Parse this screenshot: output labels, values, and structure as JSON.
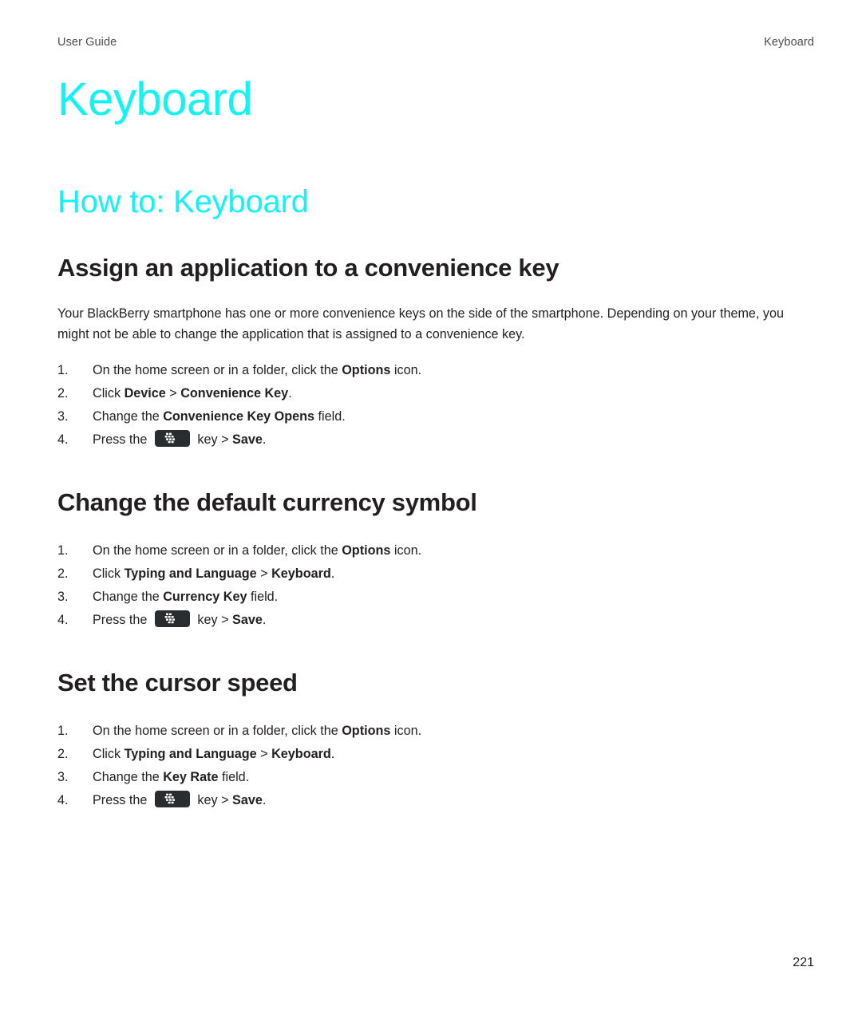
{
  "header": {
    "left": "User Guide",
    "right": "Keyboard"
  },
  "doc": {
    "title": "Keyboard",
    "section_title": "How to: Keyboard",
    "accent_color": "#12f3f3",
    "text_color": "#231f20",
    "page_number": "221"
  },
  "tasks": [
    {
      "title": "Assign an application to a convenience key",
      "intro": "Your BlackBerry smartphone has one or more convenience keys on the side of the smartphone. Depending on your theme, you might not be able to change the application that is assigned to a convenience key.",
      "steps": [
        {
          "num": "1.",
          "parts": [
            {
              "t": "On the home screen or in a folder, click the ",
              "b": false
            },
            {
              "t": "Options",
              "b": true
            },
            {
              "t": " icon.",
              "b": false
            }
          ]
        },
        {
          "num": "2.",
          "parts": [
            {
              "t": "Click ",
              "b": false
            },
            {
              "t": "Device",
              "b": true
            },
            {
              "t": " > ",
              "b": false
            },
            {
              "t": "Convenience Key",
              "b": true
            },
            {
              "t": ".",
              "b": false
            }
          ]
        },
        {
          "num": "3.",
          "parts": [
            {
              "t": "Change the ",
              "b": false
            },
            {
              "t": "Convenience Key Opens",
              "b": true
            },
            {
              "t": " field.",
              "b": false
            }
          ]
        },
        {
          "num": "4.",
          "icon": "blackberry-menu-key-icon",
          "parts": [
            {
              "t": "Press the ",
              "b": false
            },
            {
              "icon": "blackberry-menu-key-icon"
            },
            {
              "t": " key > ",
              "b": false
            },
            {
              "t": "Save",
              "b": true
            },
            {
              "t": ".",
              "b": false
            }
          ]
        }
      ]
    },
    {
      "title": "Change the default currency symbol",
      "intro": "",
      "steps": [
        {
          "num": "1.",
          "parts": [
            {
              "t": "On the home screen or in a folder, click the ",
              "b": false
            },
            {
              "t": "Options",
              "b": true
            },
            {
              "t": " icon.",
              "b": false
            }
          ]
        },
        {
          "num": "2.",
          "parts": [
            {
              "t": "Click ",
              "b": false
            },
            {
              "t": "Typing and Language",
              "b": true
            },
            {
              "t": " > ",
              "b": false
            },
            {
              "t": "Keyboard",
              "b": true
            },
            {
              "t": ".",
              "b": false
            }
          ]
        },
        {
          "num": "3.",
          "parts": [
            {
              "t": "Change the ",
              "b": false
            },
            {
              "t": "Currency Key",
              "b": true
            },
            {
              "t": " field.",
              "b": false
            }
          ]
        },
        {
          "num": "4.",
          "icon": "blackberry-menu-key-icon",
          "parts": [
            {
              "t": "Press the ",
              "b": false
            },
            {
              "icon": "blackberry-menu-key-icon"
            },
            {
              "t": " key > ",
              "b": false
            },
            {
              "t": "Save",
              "b": true
            },
            {
              "t": ".",
              "b": false
            }
          ]
        }
      ]
    },
    {
      "title": "Set the cursor speed",
      "intro": "",
      "steps": [
        {
          "num": "1.",
          "parts": [
            {
              "t": "On the home screen or in a folder, click the ",
              "b": false
            },
            {
              "t": "Options",
              "b": true
            },
            {
              "t": " icon.",
              "b": false
            }
          ]
        },
        {
          "num": "2.",
          "parts": [
            {
              "t": "Click ",
              "b": false
            },
            {
              "t": "Typing and Language",
              "b": true
            },
            {
              "t": " > ",
              "b": false
            },
            {
              "t": "Keyboard",
              "b": true
            },
            {
              "t": ".",
              "b": false
            }
          ]
        },
        {
          "num": "3.",
          "parts": [
            {
              "t": "Change the ",
              "b": false
            },
            {
              "t": "Key Rate",
              "b": true
            },
            {
              "t": " field.",
              "b": false
            }
          ]
        },
        {
          "num": "4.",
          "icon": "blackberry-menu-key-icon",
          "parts": [
            {
              "t": "Press the ",
              "b": false
            },
            {
              "icon": "blackberry-menu-key-icon"
            },
            {
              "t": " key > ",
              "b": false
            },
            {
              "t": "Save",
              "b": true
            },
            {
              "t": ".",
              "b": false
            }
          ]
        }
      ]
    }
  ]
}
